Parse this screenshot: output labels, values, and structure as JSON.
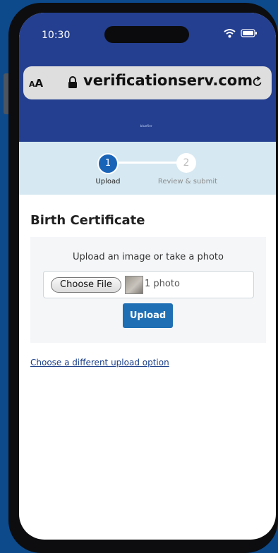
{
  "status_bar": {
    "time": "10:30"
  },
  "address_bar": {
    "text_size_label": "AA",
    "url": "verificationserv.com"
  },
  "brand": {
    "logo_text": "bluefier"
  },
  "steps": [
    {
      "number": "1",
      "label": "Upload"
    },
    {
      "number": "2",
      "label": "Review & submit"
    }
  ],
  "page": {
    "title": "Birth Certificate",
    "instruction": "Upload an image or take a photo",
    "choose_file_label": "Choose File",
    "selected_file_text": "1 photo",
    "upload_button_label": "Upload",
    "alternate_link": "Choose a different upload option"
  },
  "colors": {
    "header_blue": "#243f8f",
    "step_active": "#1a64b8",
    "upload_button": "#1f6fb4",
    "stepper_bg": "#d6e8f1"
  }
}
